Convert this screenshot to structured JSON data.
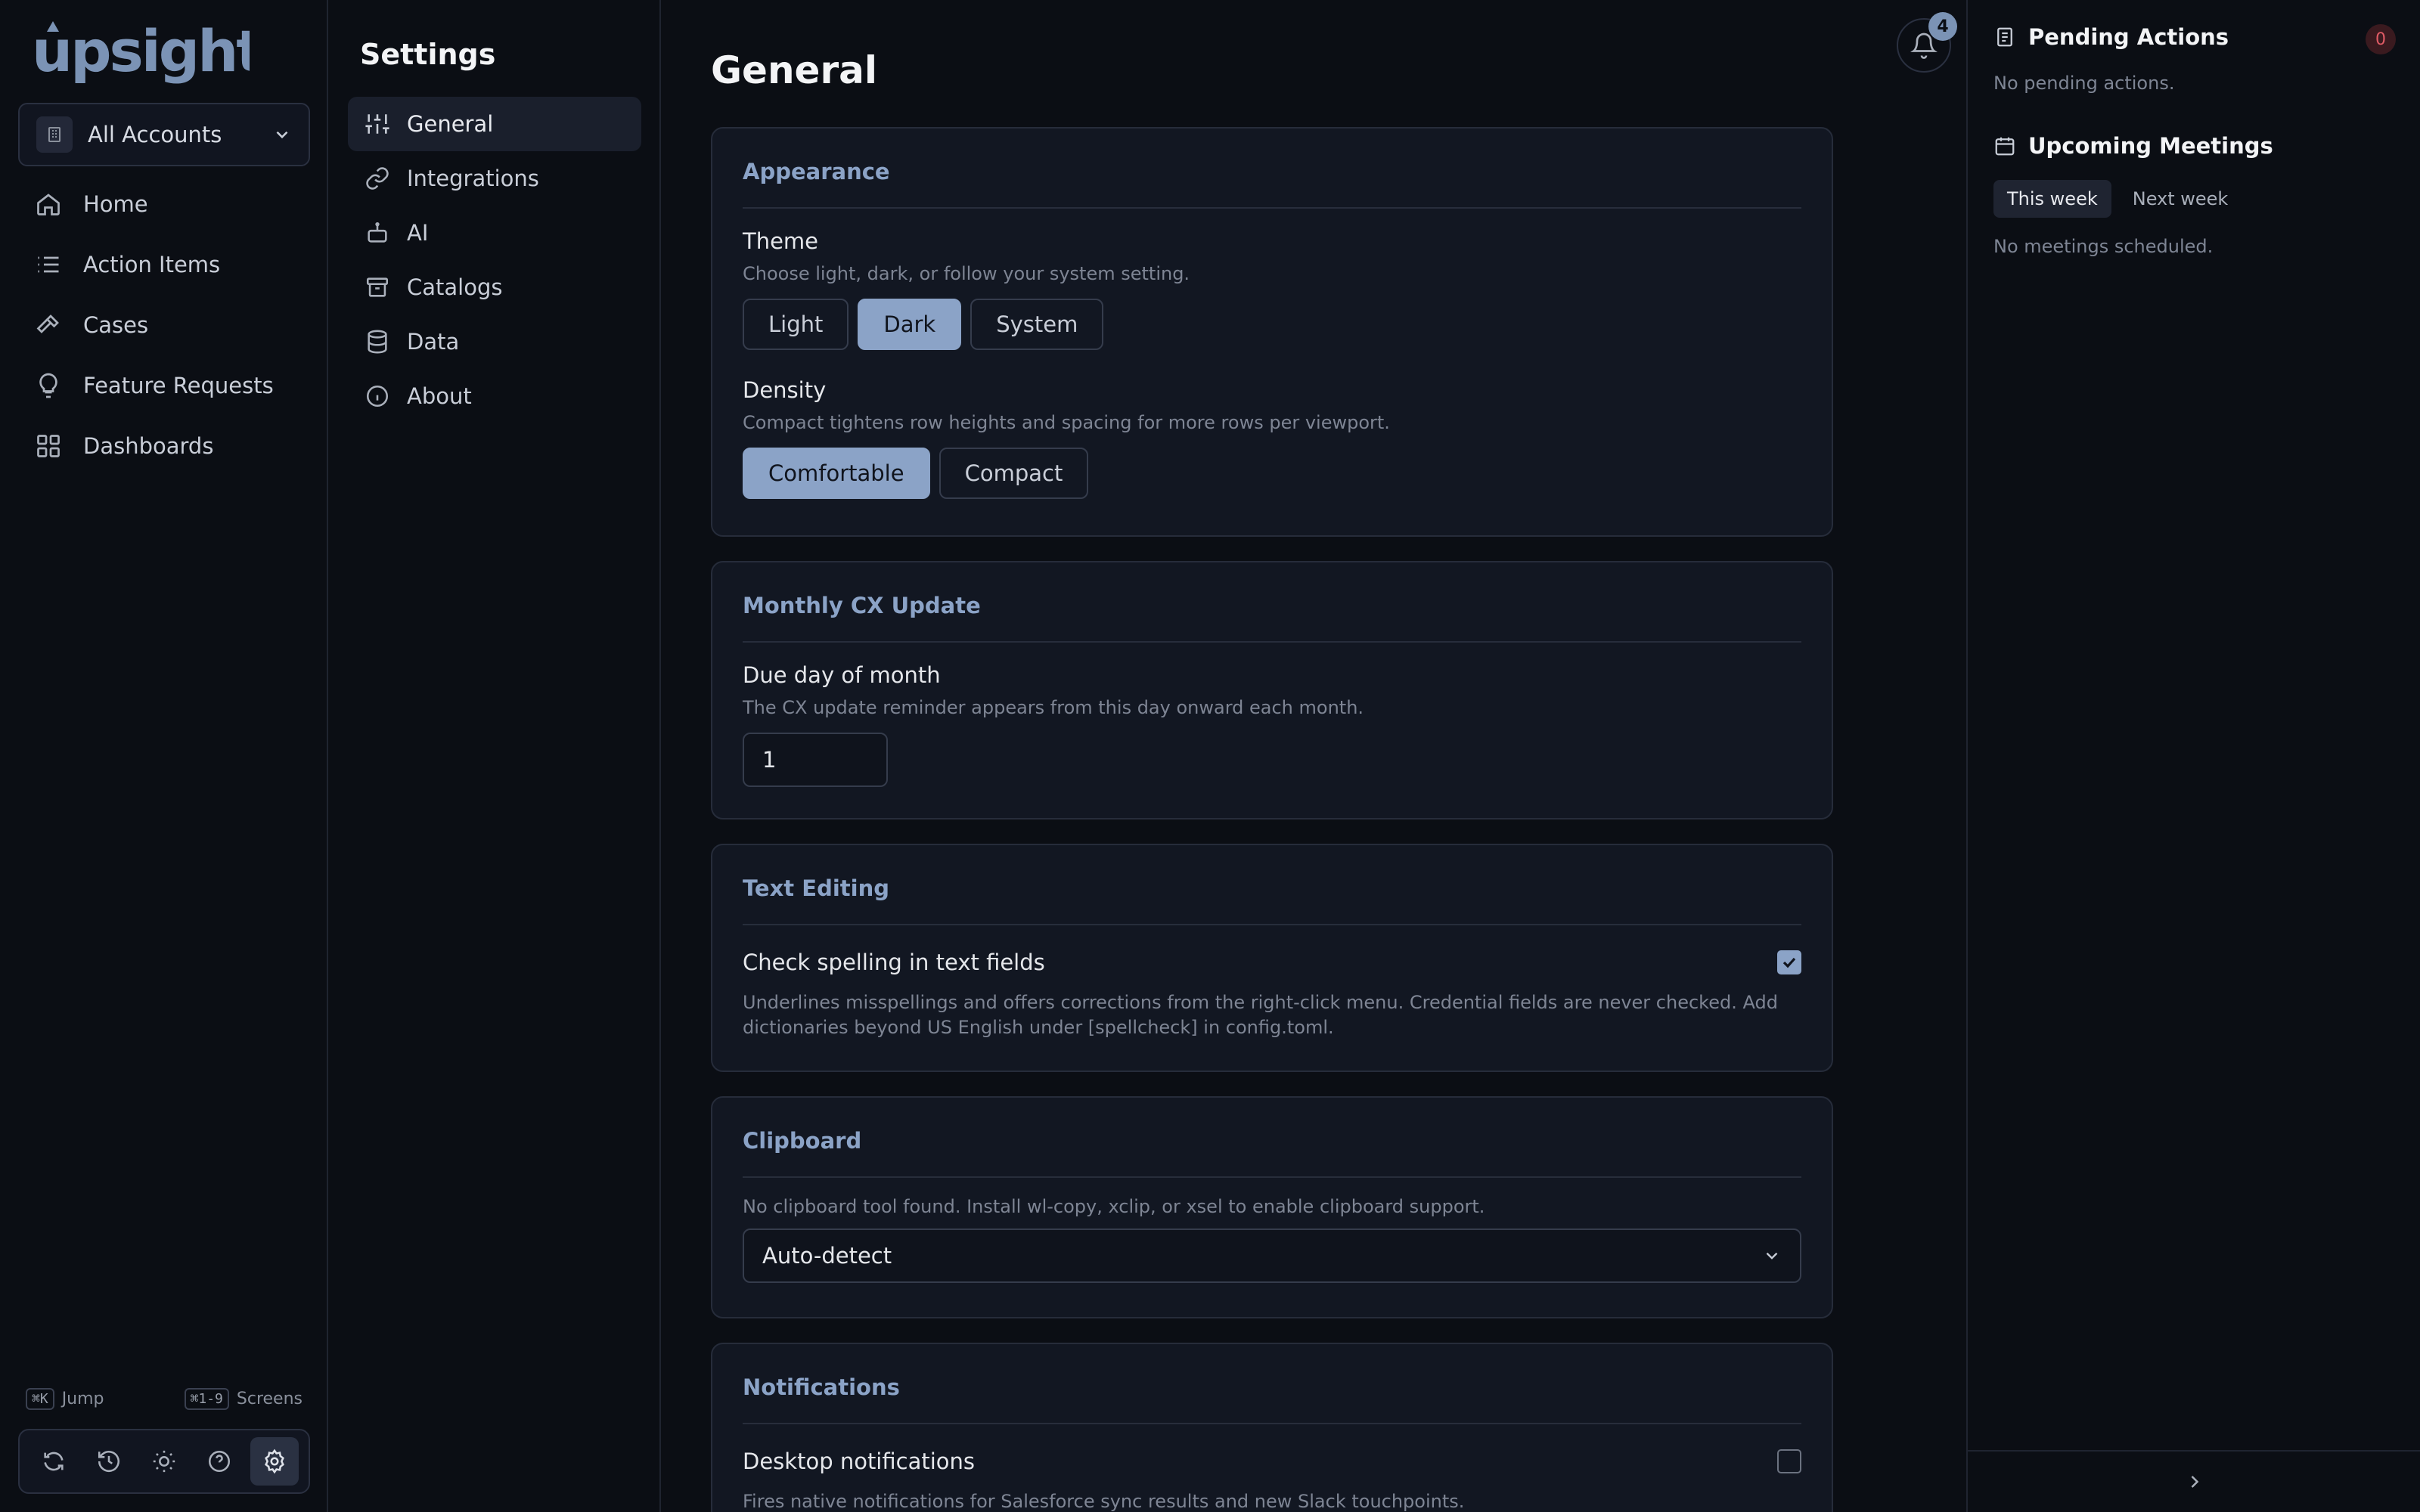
{
  "app": {
    "logo_text": "upsight",
    "account_selector": "All Accounts"
  },
  "nav": {
    "items": [
      {
        "label": "Home",
        "icon": "home-icon"
      },
      {
        "label": "Action Items",
        "icon": "list-icon"
      },
      {
        "label": "Cases",
        "icon": "hammer-icon"
      },
      {
        "label": "Feature Requests",
        "icon": "lightbulb-icon"
      },
      {
        "label": "Dashboards",
        "icon": "grid-icon"
      }
    ],
    "shortcut_jump_key": "⌘K",
    "shortcut_jump_label": "Jump",
    "shortcut_screens_key": "⌘1-9",
    "shortcut_screens_label": "Screens"
  },
  "settings_nav": {
    "title": "Settings",
    "items": [
      {
        "label": "General",
        "icon": "sliders-icon",
        "active": true
      },
      {
        "label": "Integrations",
        "icon": "link-icon"
      },
      {
        "label": "AI",
        "icon": "bot-icon"
      },
      {
        "label": "Catalogs",
        "icon": "archive-icon"
      },
      {
        "label": "Data",
        "icon": "database-icon"
      },
      {
        "label": "About",
        "icon": "info-icon"
      }
    ]
  },
  "main": {
    "title": "General",
    "notification_count": "4",
    "appearance": {
      "title": "Appearance",
      "theme_label": "Theme",
      "theme_help": "Choose light, dark, or follow your system setting.",
      "theme_options": [
        "Light",
        "Dark",
        "System"
      ],
      "theme_selected": "Dark",
      "density_label": "Density",
      "density_help": "Compact tightens row heights and spacing for more rows per viewport.",
      "density_options": [
        "Comfortable",
        "Compact"
      ],
      "density_selected": "Comfortable"
    },
    "cx_update": {
      "title": "Monthly CX Update",
      "due_label": "Due day of month",
      "due_help": "The CX update reminder appears from this day onward each month.",
      "due_value": "1"
    },
    "text_editing": {
      "title": "Text Editing",
      "spell_label": "Check spelling in text fields",
      "spell_help": "Underlines misspellings and offers corrections from the right-click menu. Credential fields are never checked. Add dictionaries beyond US English under [spellcheck] in config.toml.",
      "spell_checked": true
    },
    "clipboard": {
      "title": "Clipboard",
      "help": "No clipboard tool found. Install wl-copy, xclip, or xsel to enable clipboard support.",
      "selected": "Auto-detect"
    },
    "notifications": {
      "title": "Notifications",
      "desktop_label": "Desktop notifications",
      "desktop_help": "Fires native notifications for Salesforce sync results and new Slack touchpoints.",
      "desktop_checked": false
    }
  },
  "right_panel": {
    "pending_title": "Pending Actions",
    "pending_count": "0",
    "pending_empty": "No pending actions.",
    "meetings_title": "Upcoming Meetings",
    "week_tabs": [
      "This week",
      "Next week"
    ],
    "week_selected": "This week",
    "meetings_empty": "No meetings scheduled."
  },
  "colors": {
    "accent": "#8ba3c7",
    "background": "#0b0e14",
    "card": "#121722",
    "danger": "#e05b65"
  }
}
